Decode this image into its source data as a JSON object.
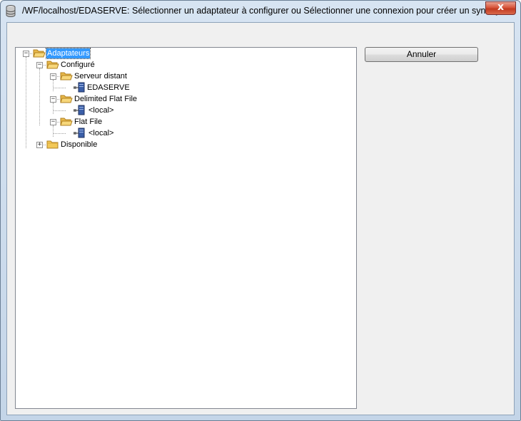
{
  "window": {
    "title": "/WF/localhost/EDASERVE: Sélectionner un adaptateur à configurer ou Sélectionner une connexion pour créer un synony...",
    "close_glyph": "x"
  },
  "buttons": {
    "cancel_label": "Annuler"
  },
  "tree": {
    "root": "Adaptateurs",
    "configured": "Configuré",
    "remote_server": "Serveur distant",
    "edaserve": "EDASERVE",
    "delimited_flat_file": "Delimited Flat File",
    "local_1": "<local>",
    "flat_file": "Flat File",
    "local_2": "<local>",
    "available": "Disponible"
  },
  "icons": {
    "folder": "folder-icon",
    "connection": "database-connection-icon"
  },
  "colors": {
    "selection": "#3399ff",
    "close_button": "#c23a20",
    "folder": "#f5c85a"
  }
}
